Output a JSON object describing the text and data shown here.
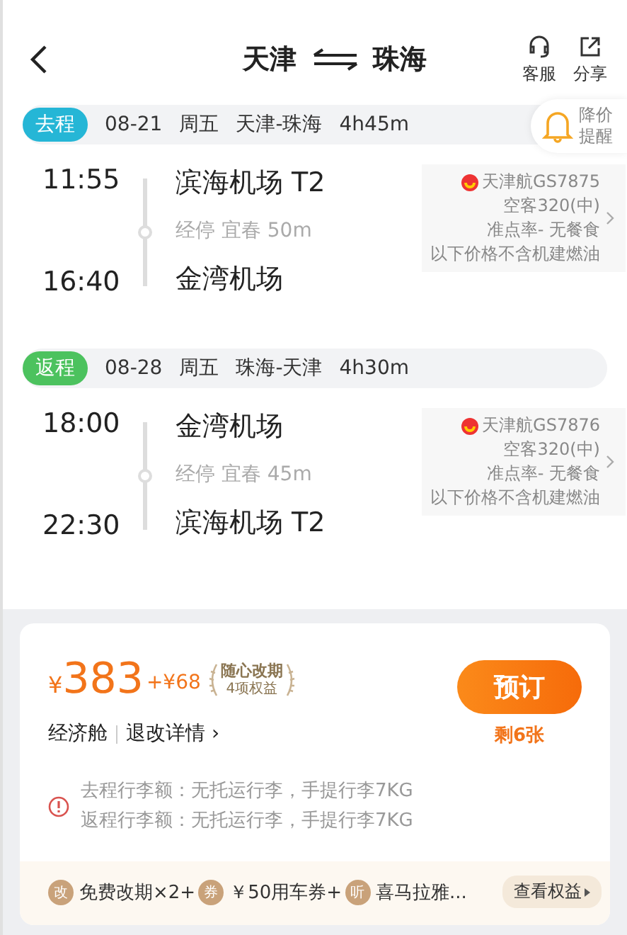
{
  "header": {
    "from": "天津",
    "to": "珠海",
    "actions": [
      {
        "kind": "service",
        "label": "客服"
      },
      {
        "kind": "share",
        "label": "分享"
      }
    ]
  },
  "price_alert": {
    "label": "降价提醒"
  },
  "legs": [
    {
      "tag": "去程",
      "color": "#25b6d6",
      "date": "08-21",
      "weekday": "周五",
      "route": "天津-珠海",
      "duration": "4h45m",
      "depart_time": "11:55",
      "depart_airport": "滨海机场 T2",
      "stop": "经停 宜春 50m",
      "arrive_time": "16:40",
      "arrive_airport": "金湾机场",
      "airline": "天津航GS7875",
      "aircraft": "空客320(中)",
      "punctuality": "准点率- 无餐食",
      "note": "以下价格不含机建燃油"
    },
    {
      "tag": "返程",
      "color": "#4cc25e",
      "date": "08-28",
      "weekday": "周五",
      "route": "珠海-天津",
      "duration": "4h30m",
      "depart_time": "18:00",
      "depart_airport": "金湾机场",
      "stop": "经停 宜春 45m",
      "arrive_time": "22:30",
      "arrive_airport": "滨海机场 T2",
      "airline": "天津航GS7876",
      "aircraft": "空客320(中)",
      "punctuality": "准点率- 无餐食",
      "note": "以下价格不含机建燃油"
    }
  ],
  "offer": {
    "currency": "¥",
    "price": "383",
    "extra": "+¥68",
    "badge_title": "随心改期",
    "badge_sub": "4项权益",
    "cabin": "经济舱",
    "refund": "退改详情 ›",
    "book": "预订",
    "remaining": "剩6张",
    "baggage": [
      "去程行李额：无托运行李，手提行李7KG",
      "返程行李额：无托运行李，手提行李7KG"
    ],
    "benefits": [
      {
        "icon": "改",
        "text": "免费改期×2+"
      },
      {
        "icon": "券",
        "text": "￥50用车券+"
      },
      {
        "icon": "听",
        "text": "喜马拉雅..."
      }
    ],
    "benefits_button": "查看权益"
  }
}
